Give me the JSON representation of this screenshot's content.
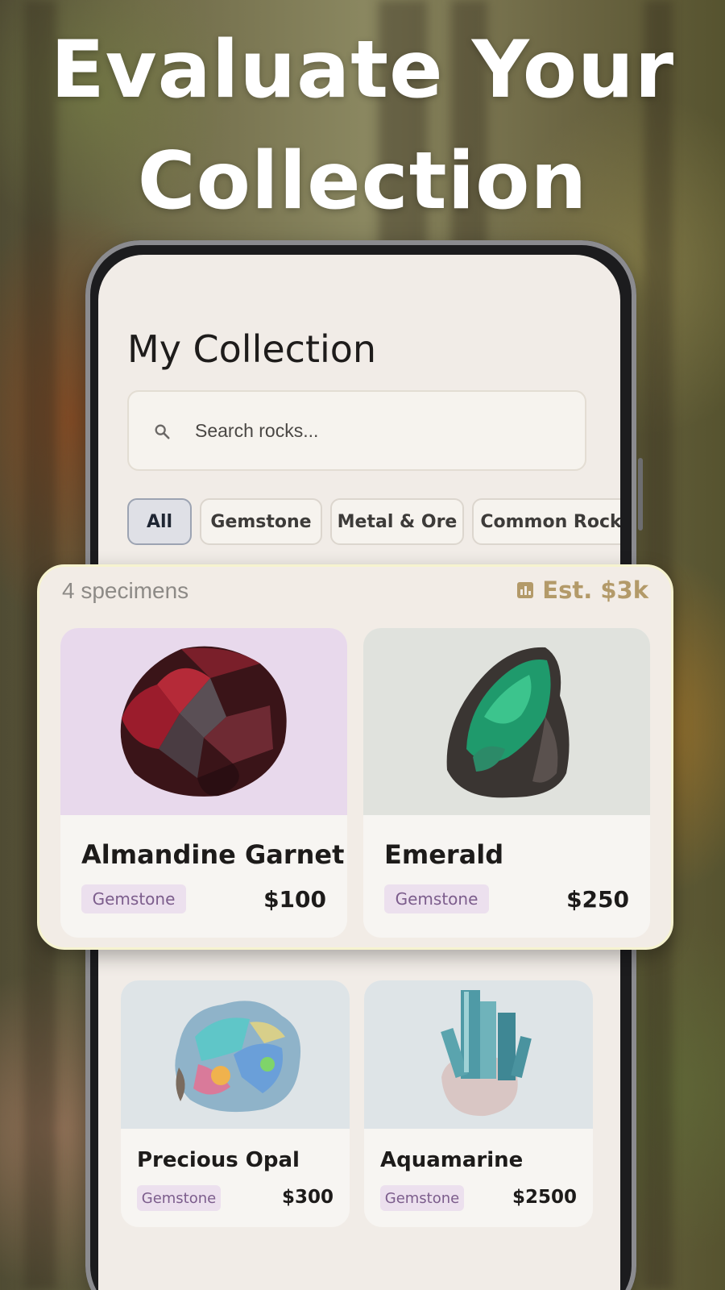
{
  "headline": {
    "line1": "Evaluate Your",
    "line2": "Collection"
  },
  "screen": {
    "title": "My Collection",
    "search": {
      "placeholder": "Search rocks...",
      "value": ""
    },
    "filters": [
      {
        "label": "All",
        "active": true
      },
      {
        "label": "Gemstone",
        "active": false
      },
      {
        "label": "Metal & Ore",
        "active": false
      },
      {
        "label": "Common Rock",
        "active": false
      }
    ]
  },
  "summary": {
    "count_text": "4 specimens",
    "estimate_text": "Est. $3k",
    "estimate_icon": "bar-chart-icon"
  },
  "specimens": [
    {
      "name": "Almandine Garnet",
      "category": "Gemstone",
      "price": "$100",
      "bg": "#e8d9ec",
      "icon": "garnet-image"
    },
    {
      "name": "Emerald",
      "category": "Gemstone",
      "price": "$250",
      "bg": "#e0e2dd",
      "icon": "emerald-image"
    },
    {
      "name": "Precious Opal",
      "category": "Gemstone",
      "price": "$300",
      "bg": "#dee4e7",
      "icon": "opal-image"
    },
    {
      "name": "Aquamarine",
      "category": "Gemstone",
      "price": "$2500",
      "bg": "#dee4e7",
      "icon": "aquamarine-image"
    }
  ],
  "colors": {
    "accent": "#b39a69",
    "tag_bg": "#ece0ee",
    "tag_text": "#7c5d8c",
    "screen_bg": "#f1ece7"
  }
}
